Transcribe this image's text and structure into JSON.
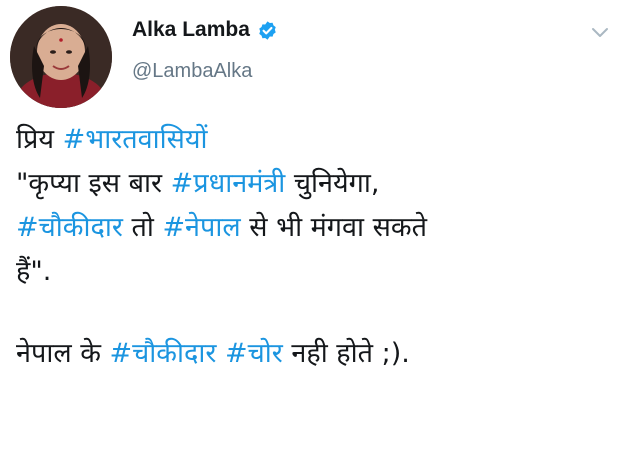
{
  "user": {
    "display_name": "Alka Lamba",
    "handle": "@LambaAlka"
  },
  "colors": {
    "hashtag": "#1b95e0",
    "verified": "#1da1f2",
    "handle": "#657786",
    "text": "#14171a"
  },
  "icons": {
    "verified": "verified-badge-icon",
    "caret": "chevron-down-icon"
  },
  "tweet": {
    "line1": {
      "t1": "प्रिय ",
      "h1": "#भारतवासियों"
    },
    "line2": {
      "t1": "\"कृप्या इस बार ",
      "h1": "#प्रधानमंत्री",
      "t2": " चुनियेगा,"
    },
    "line3": {
      "h1": "#चौकीदार",
      "t1": " तो ",
      "h2": "#नेपाल",
      "t2": " से भी मंगवा सकते"
    },
    "line4": {
      "t1": "हैं\"."
    },
    "line5": {
      "t1": "नेपाल के ",
      "h1": "#चौकीदार",
      "h2": "#चोर",
      "t2": " नही होते ;)."
    }
  }
}
